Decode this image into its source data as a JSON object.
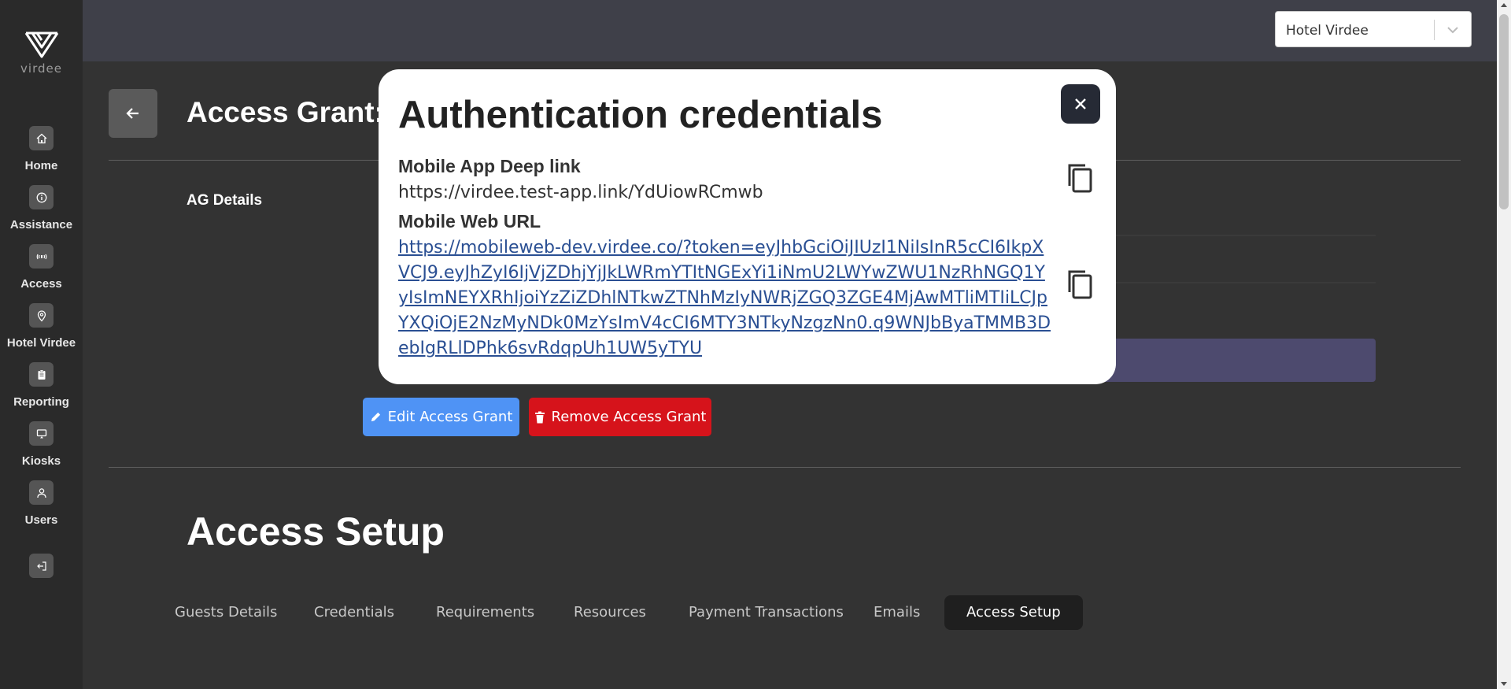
{
  "sidebar": {
    "logo_text": "virdee",
    "items": [
      {
        "label": "Home",
        "icon": "home-icon"
      },
      {
        "label": "Assistance",
        "icon": "info-icon"
      },
      {
        "label": "Access",
        "icon": "nfc-icon"
      },
      {
        "label": "Hotel Virdee",
        "icon": "location-pin-icon"
      },
      {
        "label": "Reporting",
        "icon": "clipboard-icon"
      },
      {
        "label": "Kiosks",
        "icon": "monitor-icon"
      },
      {
        "label": "Users",
        "icon": "user-icon"
      }
    ],
    "logout_icon": "logout-icon"
  },
  "topbar": {
    "hotel_select_value": "Hotel Virdee"
  },
  "page": {
    "title": "Access Grant:",
    "ag_details_label": "AG Details",
    "edit_button_label": "Edit Access Grant",
    "remove_button_label": "Remove Access Grant",
    "section_title": "Access Setup",
    "tabs": [
      {
        "label": "Guests Details"
      },
      {
        "label": "Credentials"
      },
      {
        "label": "Requirements"
      },
      {
        "label": "Resources"
      },
      {
        "label": "Payment Transactions"
      },
      {
        "label": "Emails"
      },
      {
        "label": "Access Setup",
        "active": true
      }
    ]
  },
  "modal": {
    "title": "Authentication credentials",
    "deep_link_label": "Mobile App Deep link",
    "deep_link_value": "https://virdee.test-app.link/YdUiowRCmwb",
    "web_url_label": "Mobile Web URL",
    "web_url_value": "https://mobileweb-dev.virdee.co/?token=eyJhbGciOiJIUzI1NiIsInR5cCI6IkpXVCJ9.eyJhZyI6IjVjZDhjYjJkLWRmYTItNGExYi1iNmU2LWYwZWU1NzRhNGQ1YyIsImNEYXRhIjoiYzZiZDhlNTkwZTNhMzIyNWRjZGQ3ZGE4MjAwMTliMTIiLCJpYXQiOjE2NzMyNDk0MzYsImV4cCI6MTY3NTkyNzgzNn0.q9WNJbByaTMMB3DebIgRLlDPhk6svRdqpUh1UW5yTYU"
  },
  "colors": {
    "edit": "#4f93f5",
    "remove": "#d6131b",
    "modal_close": "#262a35",
    "link": "#2a4f93"
  }
}
